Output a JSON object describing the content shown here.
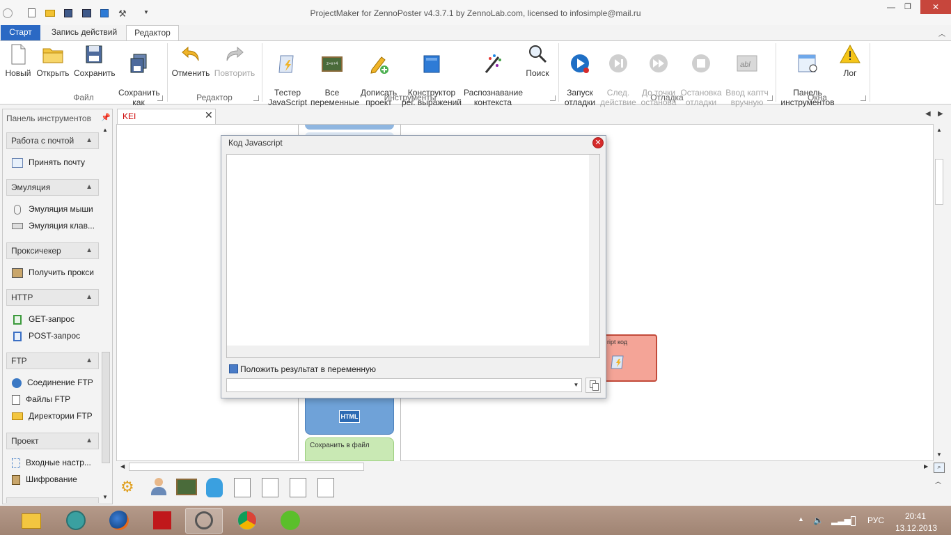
{
  "window": {
    "title": "ProjectMaker for ZennoPoster v4.3.7.1 by ZennoLab.com, licensed to infosimple@mail.ru"
  },
  "ribbon_tabs": [
    "Старт",
    "Запись действий",
    "Редактор"
  ],
  "ribbon": {
    "file": {
      "group": "Файл",
      "new": "Новый",
      "open": "Открыть",
      "save": "Сохранить",
      "save_as": "Сохранить\nкак"
    },
    "editor": {
      "group": "Редактор",
      "undo": "Отменить",
      "redo": "Повторить"
    },
    "tools": {
      "group": "Инструменты",
      "js_tester": "Тестер\nJavaScript",
      "all_vars": "Все\nпеременные",
      "append": "Дописать\nпроект",
      "regex": "Конструктор\nрег. выражений",
      "context": "Распознавание\nконтекста",
      "search": "Поиск"
    },
    "debug": {
      "group": "Отладка",
      "start": "Запуск\nотладки",
      "next": "След.\nдействие",
      "to_break": "До точки\nостанова",
      "stop": "Остановка\nотладки",
      "captcha": "Ввод каптч\nвручную"
    },
    "windows": {
      "group": "Окна",
      "toolbox": "Панель\nинструментов",
      "log": "Лог"
    }
  },
  "left_panel": {
    "title": "Панель инструментов",
    "categories": [
      {
        "name": "Работа с почтой",
        "items": [
          "Принять почту"
        ]
      },
      {
        "name": "Эмуляция",
        "items": [
          "Эмуляция мыши",
          "Эмуляция клав..."
        ]
      },
      {
        "name": "Проксичекер",
        "items": [
          "Получить прокси"
        ]
      },
      {
        "name": "HTTP",
        "items": [
          "GET-запрос",
          "POST-запрос"
        ]
      },
      {
        "name": "FTP",
        "items": [
          "Соединение FTP",
          "Файлы FTP",
          "Директории FTP"
        ]
      },
      {
        "name": "Проект",
        "items": [
          "Входные настр...",
          "Шифрование"
        ]
      }
    ]
  },
  "editor_tab": {
    "label": "KEI"
  },
  "canvas": {
    "block_js": "ript код",
    "block_save": "Сохранить в файл",
    "html_badge": "HTML"
  },
  "dialog": {
    "title": "Код Javascript",
    "code": "",
    "checkbox_label": "Положить результат в переменную",
    "variable_value": ""
  },
  "taskbar": {
    "lang": "РУС",
    "time": "20:41",
    "date": "13.12.2013"
  }
}
